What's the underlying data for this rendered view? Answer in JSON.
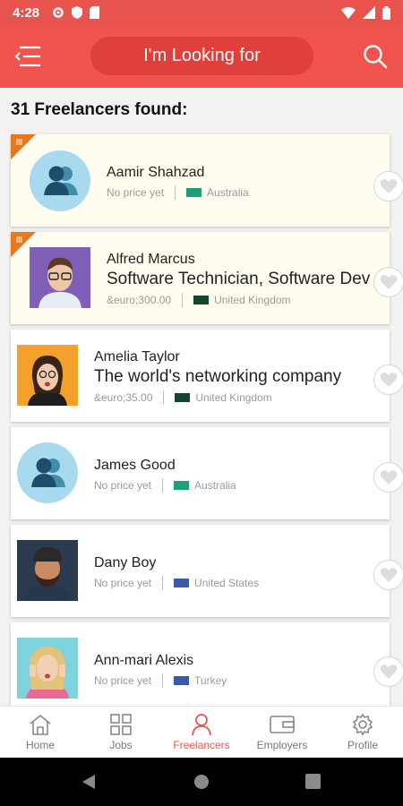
{
  "status_bar": {
    "time": "4:28"
  },
  "header": {
    "search_placeholder": "I'm Looking for"
  },
  "results": {
    "count_text": "31 Freelancers found:"
  },
  "freelancers": [
    {
      "name": "Aamir Shahzad",
      "tagline": "",
      "price": "No price yet",
      "country": "Australia",
      "featured": true,
      "avatar": "default-avatar"
    },
    {
      "name": "Alfred Marcus",
      "tagline": "Software Technician, Software Dev",
      "price": "&euro;300.00",
      "country": "United Kingdom",
      "featured": true,
      "avatar": "photo"
    },
    {
      "name": "Amelia Taylor",
      "tagline": "The world's networking company",
      "price": "&euro;35.00",
      "country": "United Kingdom",
      "featured": false,
      "avatar": "photo"
    },
    {
      "name": "James Good",
      "tagline": "",
      "price": "No price yet",
      "country": "Australia",
      "featured": false,
      "avatar": "default-avatar"
    },
    {
      "name": "Dany Boy",
      "tagline": "",
      "price": "No price yet",
      "country": "United States",
      "featured": false,
      "avatar": "photo"
    },
    {
      "name": "Ann-mari Alexis",
      "tagline": "",
      "price": "No price yet",
      "country": "Turkey",
      "featured": false,
      "avatar": "photo"
    }
  ],
  "bottom_nav": [
    {
      "label": "Home",
      "icon": "home-icon",
      "active": false
    },
    {
      "label": "Jobs",
      "icon": "grid-icon",
      "active": false
    },
    {
      "label": "Freelancers",
      "icon": "person-icon",
      "active": true
    },
    {
      "label": "Employers",
      "icon": "wallet-icon",
      "active": false
    },
    {
      "label": "Profile",
      "icon": "gear-icon",
      "active": false
    }
  ],
  "colors": {
    "brand": "#f0544f",
    "featured_bg": "#fffcf0",
    "corner": "#e8781e"
  }
}
